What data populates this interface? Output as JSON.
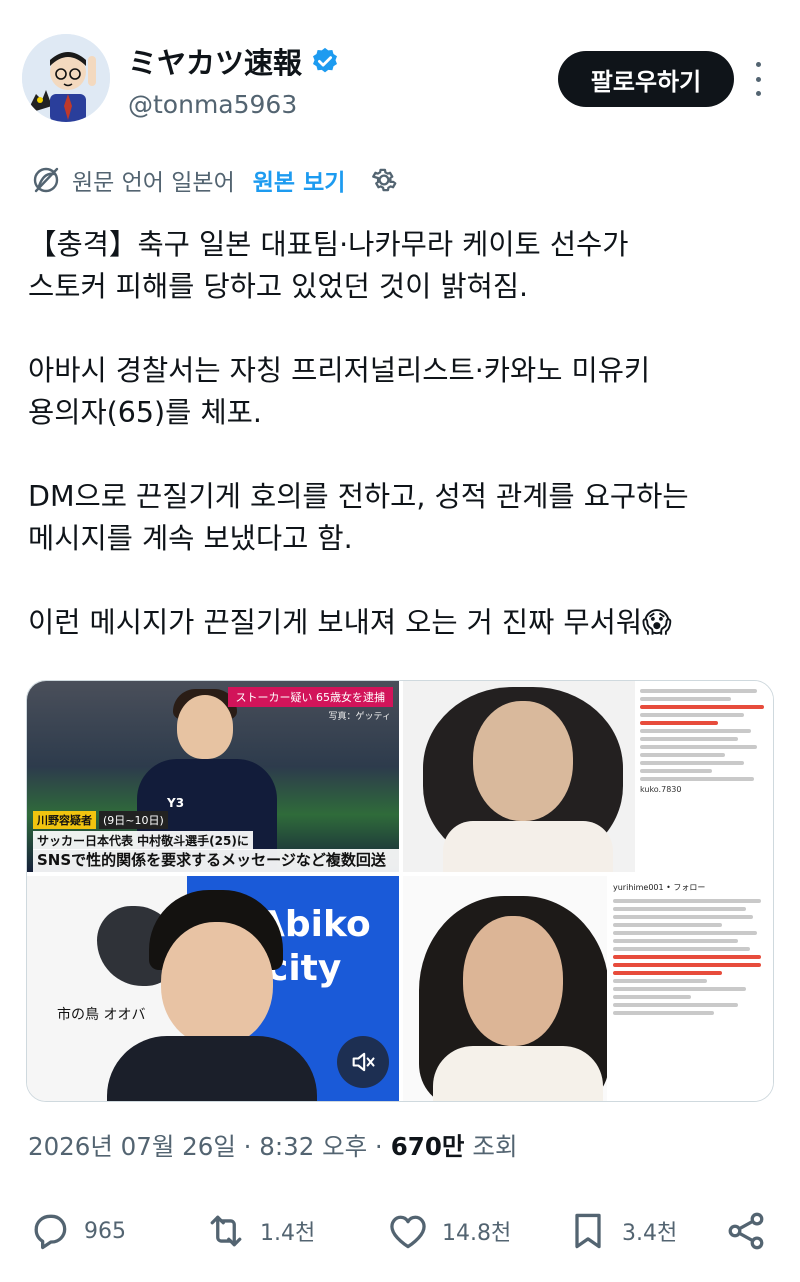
{
  "author": {
    "display_name": "ミヤカツ速報",
    "handle": "@tonma5963",
    "verified": true,
    "follow_label": "팔로우하기"
  },
  "translation": {
    "label": "원문 언어 일본어",
    "link": "원본 보기"
  },
  "tweet": {
    "text": "【충격】축구 일본 대표팀·나카무라 케이토 선수가\n스토커 피해를 당하고 있었던 것이 밝혀짐.\n\n아바시 경찰서는 자칭 프리저널리스트·카와노 미유키\n용의자(65)를 체포.\n\nDM으로 끈질기게 호의를 전하고, 성적 관계를 요구하는\n메시지를 계속 보냈다고 함.\n\n이런 메시지가 끈질기게 보내져 오는 거 진짜 무서워😱"
  },
  "media": {
    "tv_banner": "ストーカー疑い 65歳女を逮捕",
    "tv_credit": "写真：ゲッティ",
    "tv_name_tag": "川野容疑者",
    "tv_date": "(9日~10日)",
    "tv_caption_1": "サッカー日本代表 中村敬斗選手(25)に",
    "tv_caption_2": "SNSで性的関係を要求するメッセージなど複数回送り",
    "kit_logo": "Y3",
    "abiko_word_1": "Abiko",
    "abiko_word_2": "city",
    "bird_label": "市の鳥 オオバ",
    "insta_user_1": "yurihime001 • フォロー",
    "insta_user_2": "kuko.7830"
  },
  "meta": {
    "date_time": "2026년 07월 26일 · 8:32 오후 ·",
    "views": "670만",
    "views_label": "조회"
  },
  "actions": {
    "replies": "965",
    "reposts": "1.4천",
    "likes": "14.8천",
    "bookmarks": "3.4천"
  },
  "colors": {
    "accent": "#1d9bf0",
    "text": "#0f1419",
    "secondary": "#536471"
  }
}
